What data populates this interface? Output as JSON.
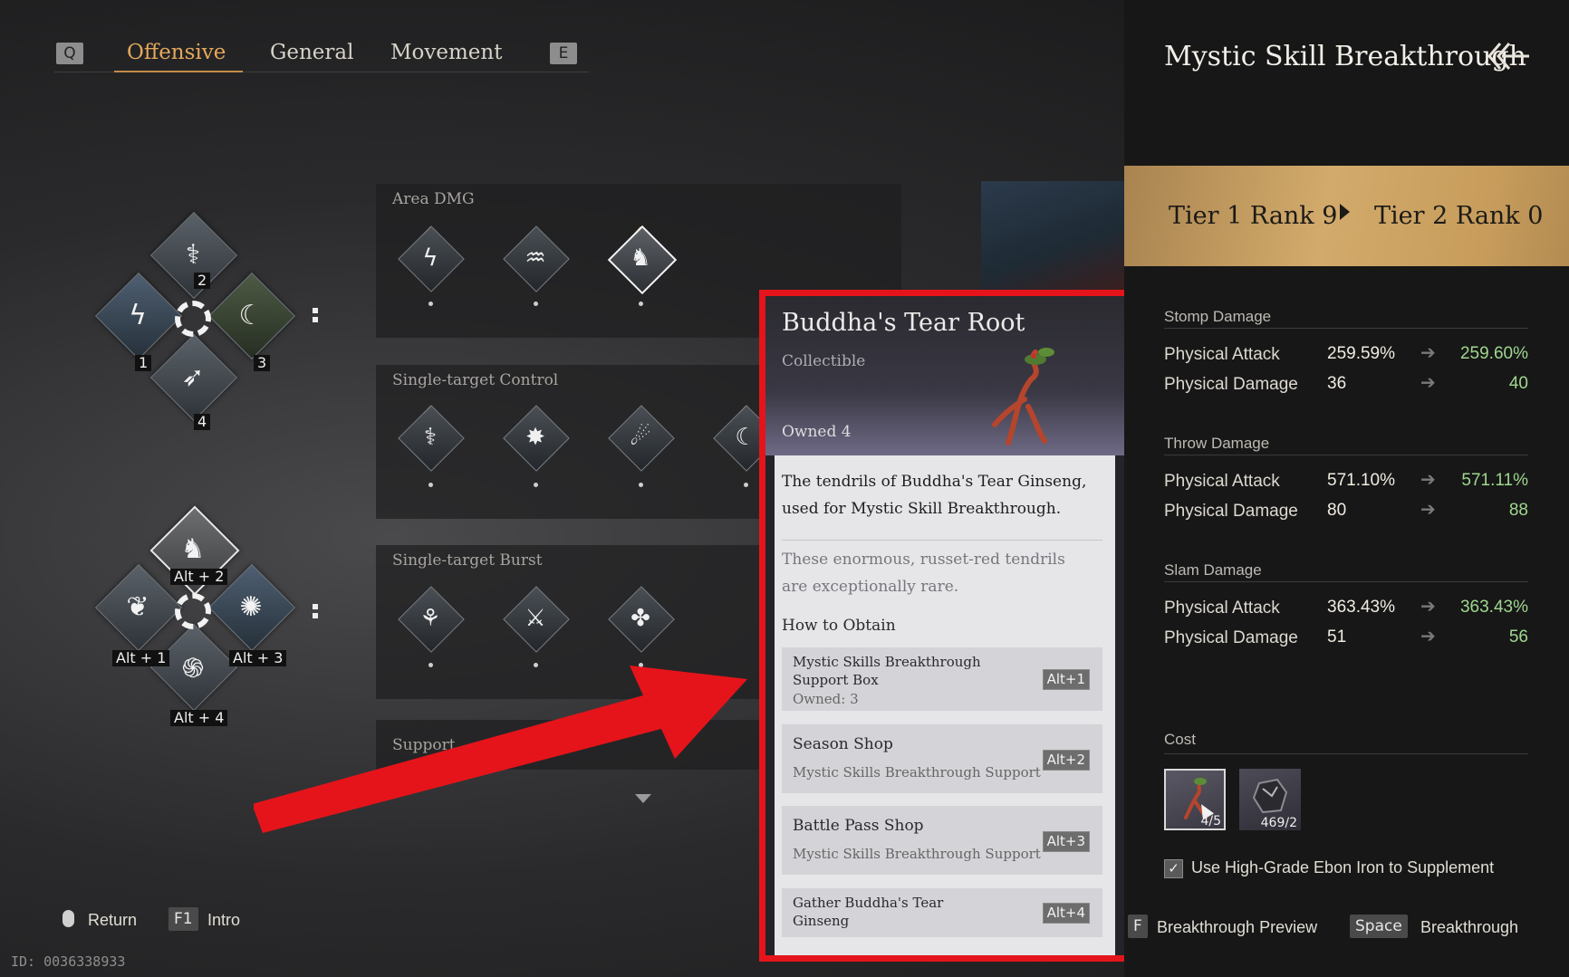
{
  "tabs": {
    "prev_key": "Q",
    "next_key": "E",
    "items": [
      {
        "label": "Offensive",
        "active": true
      },
      {
        "label": "General",
        "active": false
      },
      {
        "label": "Movement",
        "active": false
      }
    ]
  },
  "wheel_top": {
    "slot_top": "2",
    "slot_left": "1",
    "slot_right": "3",
    "slot_bottom": "4"
  },
  "wheel_bottom": {
    "slot_top": "Alt + 2",
    "slot_left": "Alt + 1",
    "slot_right": "Alt + 3",
    "slot_bottom": "Alt + 4"
  },
  "categories": [
    {
      "title": "Area DMG"
    },
    {
      "title": "Single-target Control"
    },
    {
      "title": "Single-target Burst"
    },
    {
      "title": "Support"
    }
  ],
  "tooltip": {
    "item_name": "Buddha's Tear Root",
    "item_type": "Collectible",
    "owned": "Owned 4",
    "description": "The tendrils of Buddha's Tear Ginseng, used for Mystic Skill Breakthrough.",
    "lore": "These enormous, russet-red tendrils are exceptionally rare.",
    "how_to_obtain_title": "How to Obtain",
    "sources": [
      {
        "title": "Mystic Skills Breakthrough Support Box",
        "subtitle": "Owned: 3",
        "key": "Alt+1"
      },
      {
        "title": "Season Shop",
        "subtitle": "Mystic Skills Breakthrough Support",
        "key": "Alt+2"
      },
      {
        "title": "Battle Pass Shop",
        "subtitle": "Mystic Skills Breakthrough Support",
        "key": "Alt+3"
      },
      {
        "title": "Gather Buddha's Tear Ginseng",
        "subtitle": "",
        "key": "Alt+4"
      }
    ]
  },
  "right_panel": {
    "title": "Mystic Skill Breakthrough",
    "tier_from": "Tier 1 Rank 9",
    "tier_to": "Tier 2 Rank 0",
    "stat_groups": [
      {
        "name": "Stomp Damage",
        "rows": [
          {
            "label": "Physical Attack",
            "current": "259.59%",
            "next": "259.60%"
          },
          {
            "label": "Physical Damage",
            "current": "36",
            "next": "40"
          }
        ]
      },
      {
        "name": "Throw Damage",
        "rows": [
          {
            "label": "Physical Attack",
            "current": "571.10%",
            "next": "571.11%"
          },
          {
            "label": "Physical Damage",
            "current": "80",
            "next": "88"
          }
        ]
      },
      {
        "name": "Slam Damage",
        "rows": [
          {
            "label": "Physical Attack",
            "current": "363.43%",
            "next": "363.43%"
          },
          {
            "label": "Physical Damage",
            "current": "51",
            "next": "56"
          }
        ]
      }
    ],
    "cost_title": "Cost",
    "cost_items": [
      {
        "icon": "ginseng-root-icon",
        "count": "4/5"
      },
      {
        "icon": "ebon-iron-icon",
        "count": "469/2"
      }
    ],
    "supplement_label": "Use High-Grade Ebon Iron to Supplement",
    "supplement_checked": true,
    "preview_key": "F",
    "preview_label": "Breakthrough Preview",
    "breakthrough_key": "Space",
    "breakthrough_label": "Breakthrough"
  },
  "footer": {
    "return_label": "Return",
    "intro_key": "F1",
    "intro_label": "Intro",
    "id_text": "ID: 0036338933"
  },
  "colors": {
    "accent_tab": "#e5a85c",
    "highlight_frame": "#e5141a",
    "stat_increase": "#9fd78e",
    "tier_banner": "#d2aa6b"
  }
}
